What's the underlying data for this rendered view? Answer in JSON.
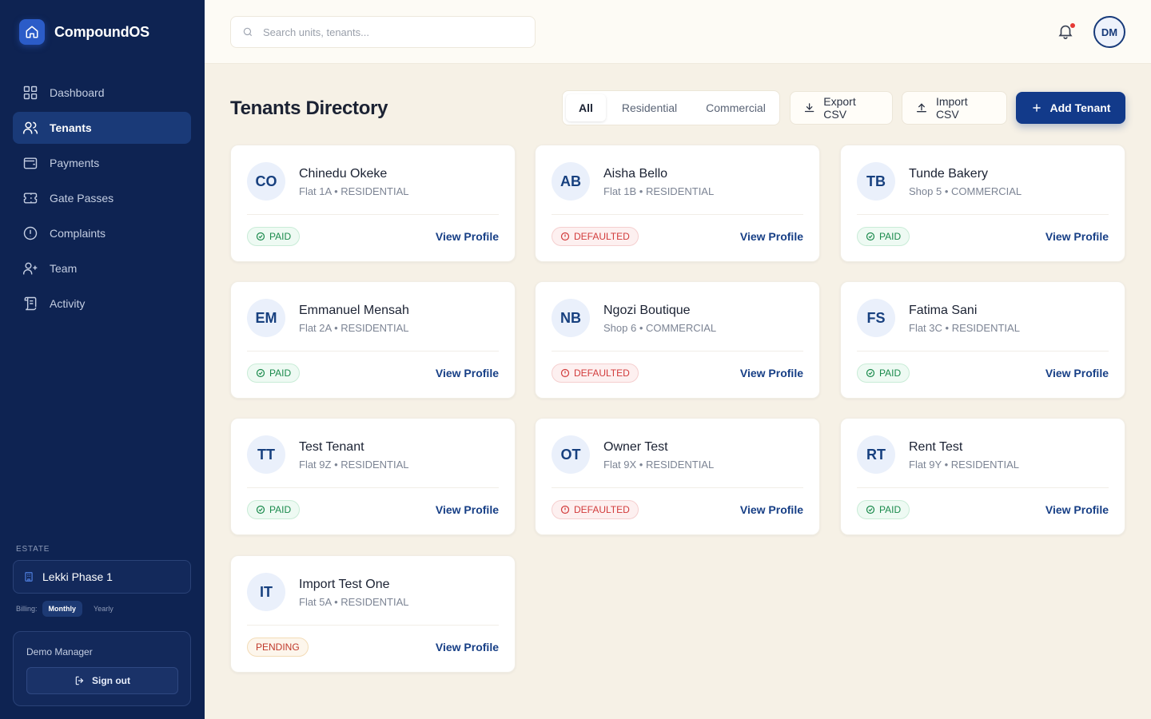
{
  "app": {
    "name": "CompoundOS"
  },
  "sidebar": {
    "items": [
      {
        "label": "Dashboard",
        "icon": "dashboard-icon",
        "active": false
      },
      {
        "label": "Tenants",
        "icon": "users-icon",
        "active": true
      },
      {
        "label": "Payments",
        "icon": "wallet-icon",
        "active": false
      },
      {
        "label": "Gate Passes",
        "icon": "ticket-icon",
        "active": false
      },
      {
        "label": "Complaints",
        "icon": "alert-circle-icon",
        "active": false
      },
      {
        "label": "Team",
        "icon": "user-plus-icon",
        "active": false
      },
      {
        "label": "Activity",
        "icon": "scroll-icon",
        "active": false
      }
    ],
    "estate_label": "ESTATE",
    "estate_name": "Lekki Phase 1",
    "billing_label": "Billing:",
    "billing_monthly": "Monthly",
    "billing_yearly": "Yearly",
    "user_name": "Demo Manager",
    "signout_label": "Sign out"
  },
  "topbar": {
    "search_placeholder": "Search units, tenants...",
    "avatar_initials": "DM"
  },
  "main": {
    "title": "Tenants Directory",
    "filters": [
      "All",
      "Residential",
      "Commercial"
    ],
    "active_filter": "All",
    "export_label": "Export CSV",
    "import_label": "Import CSV",
    "add_label": "Add Tenant"
  },
  "tenants": [
    {
      "initials": "CO",
      "name": "Chinedu Okeke",
      "unit": "Flat 1A",
      "type": "RESIDENTIAL",
      "status": "PAID",
      "link": "View Profile"
    },
    {
      "initials": "AB",
      "name": "Aisha Bello",
      "unit": "Flat 1B",
      "type": "RESIDENTIAL",
      "status": "DEFAULTED",
      "link": "View Profile"
    },
    {
      "initials": "TB",
      "name": "Tunde Bakery",
      "unit": "Shop 5",
      "type": "COMMERCIAL",
      "status": "PAID",
      "link": "View Profile"
    },
    {
      "initials": "EM",
      "name": "Emmanuel Mensah",
      "unit": "Flat 2A",
      "type": "RESIDENTIAL",
      "status": "PAID",
      "link": "View Profile"
    },
    {
      "initials": "NB",
      "name": "Ngozi Boutique",
      "unit": "Shop 6",
      "type": "COMMERCIAL",
      "status": "DEFAULTED",
      "link": "View Profile"
    },
    {
      "initials": "FS",
      "name": "Fatima Sani",
      "unit": "Flat 3C",
      "type": "RESIDENTIAL",
      "status": "PAID",
      "link": "View Profile"
    },
    {
      "initials": "TT",
      "name": "Test Tenant",
      "unit": "Flat 9Z",
      "type": "RESIDENTIAL",
      "status": "PAID",
      "link": "View Profile"
    },
    {
      "initials": "OT",
      "name": "Owner Test",
      "unit": "Flat 9X",
      "type": "RESIDENTIAL",
      "status": "DEFAULTED",
      "link": "View Profile"
    },
    {
      "initials": "RT",
      "name": "Rent Test",
      "unit": "Flat 9Y",
      "type": "RESIDENTIAL",
      "status": "PAID",
      "link": "View Profile"
    },
    {
      "initials": "IT",
      "name": "Import Test One",
      "unit": "Flat 5A",
      "type": "RESIDENTIAL",
      "status": "PENDING",
      "link": "View Profile"
    }
  ],
  "colors": {
    "sidebar_bg": "#0e2352",
    "accent": "#123a8a",
    "paid": "#1a8a4c",
    "defaulted": "#d23b3b",
    "pending": "#c0392b"
  }
}
